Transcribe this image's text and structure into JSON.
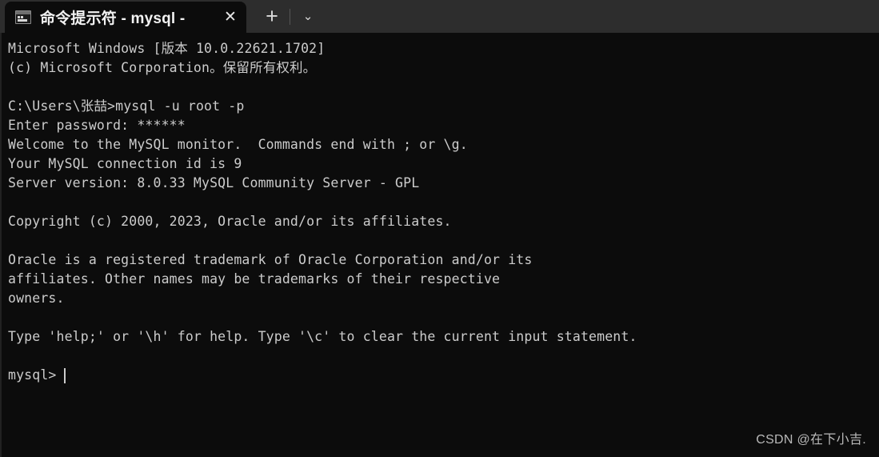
{
  "window": {
    "background_color": "#0c0c0c",
    "tabstrip_background_color": "#2d2d2d",
    "text_color": "#cccccc"
  },
  "tabstrip": {
    "tab": {
      "icon_name": "console-icon",
      "title": "命令提示符 - mysql  -",
      "close_label": "✕"
    },
    "new_tab_label": "+",
    "dropdown_label": "⌄"
  },
  "terminal": {
    "lines": [
      "Microsoft Windows [版本 10.0.22621.1702]",
      "(c) Microsoft Corporation。保留所有权利。",
      "",
      "C:\\Users\\张喆>mysql -u root -p",
      "Enter password: ******",
      "Welcome to the MySQL monitor.  Commands end with ; or \\g.",
      "Your MySQL connection id is 9",
      "Server version: 8.0.33 MySQL Community Server - GPL",
      "",
      "Copyright (c) 2000, 2023, Oracle and/or its affiliates.",
      "",
      "Oracle is a registered trademark of Oracle Corporation and/or its",
      "affiliates. Other names may be trademarks of their respective",
      "owners.",
      "",
      "Type 'help;' or '\\h' for help. Type '\\c' to clear the current input statement.",
      ""
    ],
    "prompt": "mysql>"
  },
  "watermark": {
    "text": "CSDN @在下小吉."
  }
}
